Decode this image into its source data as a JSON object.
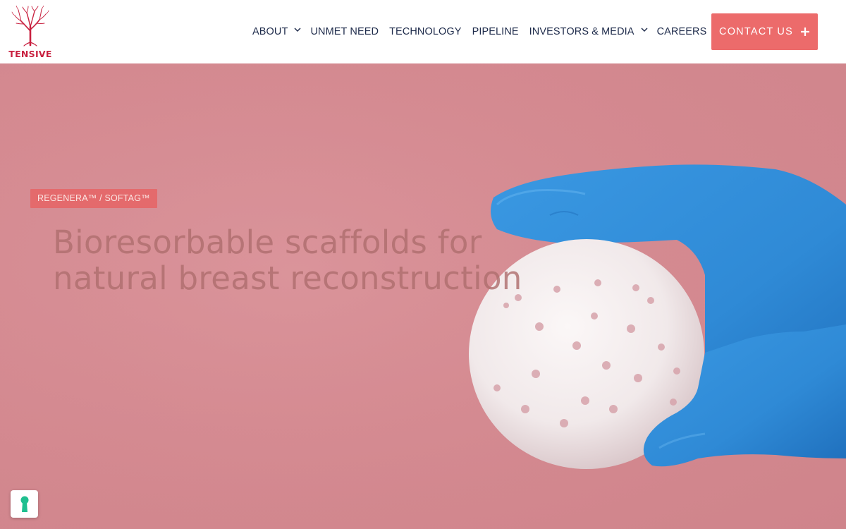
{
  "brand": {
    "name": "TENSIVE",
    "logo_icon": "tree-logo-icon",
    "brand_color": "#c8203f"
  },
  "nav": {
    "items": [
      {
        "label": "ABOUT",
        "has_dropdown": true
      },
      {
        "label": "UNMET NEED",
        "has_dropdown": false
      },
      {
        "label": "TECHNOLOGY",
        "has_dropdown": false
      },
      {
        "label": "PIPELINE",
        "has_dropdown": false
      },
      {
        "label": "INVESTORS & MEDIA",
        "has_dropdown": true
      },
      {
        "label": "CAREERS",
        "has_dropdown": false
      }
    ],
    "text_color": "#1d2a4a"
  },
  "contact": {
    "label": "CONTACT US",
    "icon": "plus-icon",
    "color": "#ec6b6b"
  },
  "hero": {
    "badge": "REGENERA™ / SOFTAG™",
    "headline_line1": "Bioresorbable scaffolds for",
    "headline_line2": "natural breast reconstruction",
    "image_description_icon": "gloved-hand-holding-scaffold-icon",
    "background_color": "#d58a91",
    "glove_color": "#2f8ad6"
  },
  "privacy": {
    "icon": "keyhole-icon",
    "icon_color": "#1fbf8f"
  }
}
